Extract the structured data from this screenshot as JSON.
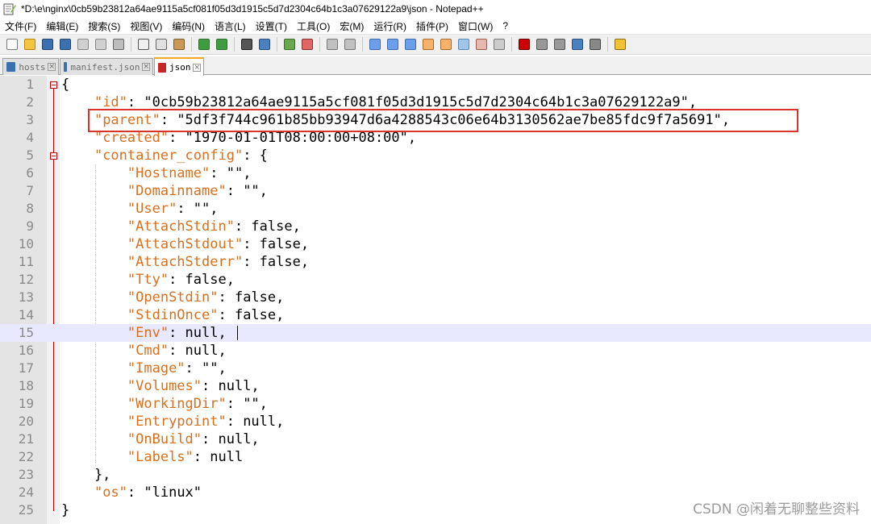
{
  "window": {
    "title": "*D:\\e\\nginx\\0cb59b23812a64ae9115a5cf081f05d3d1915c5d7d2304c64b1c3a07629122a9\\json - Notepad++"
  },
  "menu": [
    "文件(F)",
    "编辑(E)",
    "搜索(S)",
    "视图(V)",
    "编码(N)",
    "语言(L)",
    "设置(T)",
    "工具(O)",
    "宏(M)",
    "运行(R)",
    "插件(P)",
    "窗口(W)",
    "?"
  ],
  "tabs": [
    {
      "label": "hosts",
      "icon_color": "#3a6fb0"
    },
    {
      "label": "manifest.json",
      "icon_color": "#3a6fb0"
    },
    {
      "label": "json",
      "icon_color": "#c62828",
      "active": true
    }
  ],
  "editor": {
    "current_line": 15,
    "lines": [
      {
        "n": "1",
        "parts": [
          [
            "p",
            "{"
          ]
        ]
      },
      {
        "n": "2",
        "parts": [
          [
            "p",
            "    "
          ],
          [
            "k",
            "\"id\""
          ],
          [
            "p",
            ": \"0cb59b23812a64ae9115a5cf081f05d3d1915c5d7d2304c64b1c3a07629122a9\","
          ]
        ]
      },
      {
        "n": "3",
        "parts": [
          [
            "p",
            "    "
          ],
          [
            "k",
            "\"parent\""
          ],
          [
            "p",
            ": \"5df3f744c961b85bb93947d6a4288543c06e64b3130562ae7be85fdc9f7a5691\","
          ]
        ]
      },
      {
        "n": "4",
        "parts": [
          [
            "p",
            "    "
          ],
          [
            "k",
            "\"created\""
          ],
          [
            "p",
            ": \"1970-01-01T08:00:00+08:00\","
          ]
        ]
      },
      {
        "n": "5",
        "parts": [
          [
            "p",
            "    "
          ],
          [
            "k",
            "\"container_config\""
          ],
          [
            "p",
            ": {"
          ]
        ]
      },
      {
        "n": "6",
        "parts": [
          [
            "p",
            "        "
          ],
          [
            "k",
            "\"Hostname\""
          ],
          [
            "p",
            ": \"\","
          ]
        ]
      },
      {
        "n": "7",
        "parts": [
          [
            "p",
            "        "
          ],
          [
            "k",
            "\"Domainname\""
          ],
          [
            "p",
            ": \"\","
          ]
        ]
      },
      {
        "n": "8",
        "parts": [
          [
            "p",
            "        "
          ],
          [
            "k",
            "\"User\""
          ],
          [
            "p",
            ": \"\","
          ]
        ]
      },
      {
        "n": "9",
        "parts": [
          [
            "p",
            "        "
          ],
          [
            "k",
            "\"AttachStdin\""
          ],
          [
            "p",
            ": false,"
          ]
        ]
      },
      {
        "n": "10",
        "parts": [
          [
            "p",
            "        "
          ],
          [
            "k",
            "\"AttachStdout\""
          ],
          [
            "p",
            ": false,"
          ]
        ]
      },
      {
        "n": "11",
        "parts": [
          [
            "p",
            "        "
          ],
          [
            "k",
            "\"AttachStderr\""
          ],
          [
            "p",
            ": false,"
          ]
        ]
      },
      {
        "n": "12",
        "parts": [
          [
            "p",
            "        "
          ],
          [
            "k",
            "\"Tty\""
          ],
          [
            "p",
            ": false,"
          ]
        ]
      },
      {
        "n": "13",
        "parts": [
          [
            "p",
            "        "
          ],
          [
            "k",
            "\"OpenStdin\""
          ],
          [
            "p",
            ": false,"
          ]
        ]
      },
      {
        "n": "14",
        "parts": [
          [
            "p",
            "        "
          ],
          [
            "k",
            "\"StdinOnce\""
          ],
          [
            "p",
            ": false,"
          ]
        ]
      },
      {
        "n": "15",
        "parts": [
          [
            "p",
            "        "
          ],
          [
            "k",
            "\"Env\""
          ],
          [
            "p",
            ": null,"
          ]
        ]
      },
      {
        "n": "16",
        "parts": [
          [
            "p",
            "        "
          ],
          [
            "k",
            "\"Cmd\""
          ],
          [
            "p",
            ": null,"
          ]
        ]
      },
      {
        "n": "17",
        "parts": [
          [
            "p",
            "        "
          ],
          [
            "k",
            "\"Image\""
          ],
          [
            "p",
            ": \"\","
          ]
        ]
      },
      {
        "n": "18",
        "parts": [
          [
            "p",
            "        "
          ],
          [
            "k",
            "\"Volumes\""
          ],
          [
            "p",
            ": null,"
          ]
        ]
      },
      {
        "n": "19",
        "parts": [
          [
            "p",
            "        "
          ],
          [
            "k",
            "\"WorkingDir\""
          ],
          [
            "p",
            ": \"\","
          ]
        ]
      },
      {
        "n": "20",
        "parts": [
          [
            "p",
            "        "
          ],
          [
            "k",
            "\"Entrypoint\""
          ],
          [
            "p",
            ": null,"
          ]
        ]
      },
      {
        "n": "21",
        "parts": [
          [
            "p",
            "        "
          ],
          [
            "k",
            "\"OnBuild\""
          ],
          [
            "p",
            ": null,"
          ]
        ]
      },
      {
        "n": "22",
        "parts": [
          [
            "p",
            "        "
          ],
          [
            "k",
            "\"Labels\""
          ],
          [
            "p",
            ": null"
          ]
        ]
      },
      {
        "n": "23",
        "parts": [
          [
            "p",
            "    },"
          ]
        ]
      },
      {
        "n": "24",
        "parts": [
          [
            "p",
            "    "
          ],
          [
            "k",
            "\"os\""
          ],
          [
            "p",
            ": \"linux\""
          ]
        ]
      },
      {
        "n": "25",
        "parts": [
          [
            "p",
            "}"
          ]
        ]
      }
    ]
  },
  "watermark": "CSDN @闲着无聊整些资料"
}
